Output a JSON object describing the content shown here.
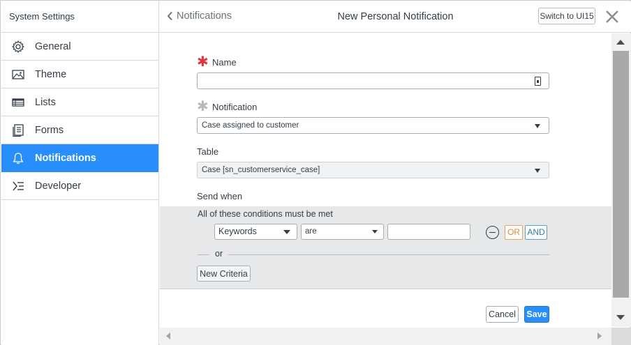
{
  "sidebar": {
    "title": "System Settings",
    "items": [
      {
        "label": "General",
        "icon": "gear-icon"
      },
      {
        "label": "Theme",
        "icon": "image-icon"
      },
      {
        "label": "Lists",
        "icon": "list-table-icon"
      },
      {
        "label": "Forms",
        "icon": "form-icon"
      },
      {
        "label": "Notifications",
        "icon": "bell-icon",
        "active": true
      },
      {
        "label": "Developer",
        "icon": "developer-icon"
      }
    ]
  },
  "header": {
    "back_label": "Notifications",
    "title": "New Personal Notification",
    "switch_label": "Switch to UI15"
  },
  "form": {
    "name_label": "Name",
    "name_value": "",
    "notification_label": "Notification",
    "notification_value": "Case assigned to customer",
    "table_label": "Table",
    "table_value": "Case [sn_customerservice_case]",
    "send_when_label": "Send when"
  },
  "conditions": {
    "title": "All of these conditions must be met",
    "field_value": "Keywords",
    "operator_value": "are",
    "value": "",
    "or_label": "OR",
    "and_label": "AND",
    "separator_text": "or",
    "new_criteria_label": "New Criteria"
  },
  "actions": {
    "cancel_label": "Cancel",
    "save_label": "Save"
  },
  "colors": {
    "accent": "#278efc",
    "required": "#e0343f",
    "or_button": "#e08a2c",
    "and_button": "#2b7bb0"
  }
}
